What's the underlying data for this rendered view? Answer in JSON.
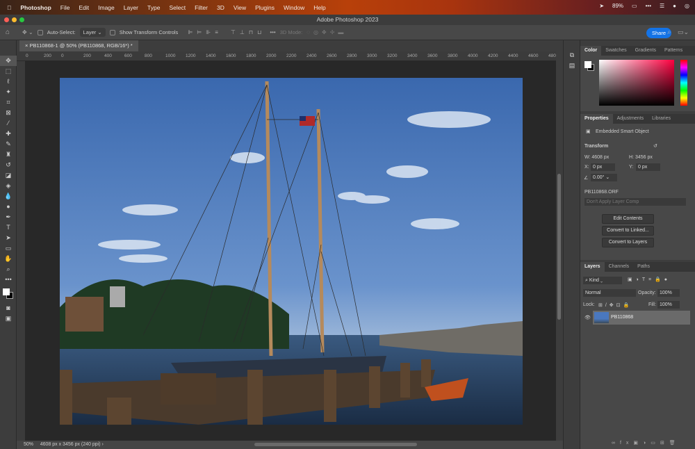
{
  "menubar": {
    "apple": "",
    "app": "Photoshop",
    "items": [
      "File",
      "Edit",
      "Image",
      "Layer",
      "Type",
      "Select",
      "Filter",
      "3D",
      "View",
      "Plugins",
      "Window",
      "Help"
    ],
    "battery": "89%"
  },
  "window": {
    "title": "Adobe Photoshop 2023"
  },
  "options": {
    "auto_select": "Auto-Select:",
    "layer_select": "Layer",
    "show_transform": "Show Transform Controls",
    "mode_3d": "3D Mode:",
    "share": "Share"
  },
  "document": {
    "tab": "PB110868-1 @ 50% (PB110868, RGB/16*) *",
    "ruler_labels": [
      "0",
      "200",
      "0",
      "200",
      "400",
      "600",
      "800",
      "1000",
      "1200",
      "1400",
      "1600",
      "1800",
      "2000",
      "2200",
      "2400",
      "2600",
      "2800",
      "3000",
      "3200",
      "3400",
      "3600",
      "3800",
      "4000",
      "4200",
      "4400",
      "4600",
      "4800"
    ]
  },
  "status": {
    "zoom": "50%",
    "info": "4608 px x 3456 px (240 ppi)"
  },
  "color_panel": {
    "tabs": [
      "Color",
      "Swatches",
      "Gradients",
      "Patterns"
    ],
    "foreground": "#ffffff",
    "background": "#000000",
    "hue": "#ff0040"
  },
  "properties": {
    "tabs": [
      "Properties",
      "Adjustments",
      "Libraries"
    ],
    "type": "Embedded Smart Object",
    "transform": "Transform",
    "w": "W: 4608 px",
    "h": "H: 3456 px",
    "x_label": "X:",
    "x": "0 px",
    "y_label": "Y:",
    "y": "0 px",
    "angle": "0.00°",
    "filename": "PB110868.ORF",
    "layer_comp": "Don't Apply Layer Comp",
    "buttons": [
      "Edit Contents",
      "Convert to Linked...",
      "Convert to Layers"
    ]
  },
  "layers": {
    "tabs": [
      "Layers",
      "Channels",
      "Paths"
    ],
    "kind": "Kind",
    "blend": "Normal",
    "opacity_label": "Opacity:",
    "opacity": "100%",
    "lock_label": "Lock:",
    "fill_label": "Fill:",
    "fill": "100%",
    "items": [
      {
        "name": "PB110868"
      }
    ]
  }
}
